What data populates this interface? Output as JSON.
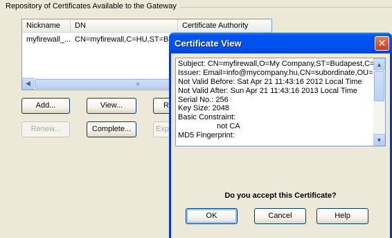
{
  "repository": {
    "title": "Repository of Certificates Available to the Gateway",
    "columns": [
      "Nickname",
      "DN",
      "Certificate Authority"
    ],
    "rows": [
      {
        "nickname": "myfirewall_...",
        "dn": "CN=myfirewall,C=HU,ST=B...",
        "ca": ""
      }
    ]
  },
  "buttons": {
    "add": "Add...",
    "view": "View...",
    "remove_partial": "R",
    "renew": "Renew...",
    "complete": "Complete...",
    "export_partial": "Exp"
  },
  "dialog": {
    "title": "Certificate View",
    "close_glyph": "✕",
    "lines": [
      "Subject: CN=myfirewall,O=My Company,ST=Budapest,C=HU",
      "Issuer: Email=info@mycompany.hu,CN=subordinate,OU=Se",
      "Not Valid Before: Sat Apr 21 11:43:16 2012 Local Time",
      "Not Valid After:  Sun Apr 21 11:43:16 2013 Local Time",
      "Serial No.:  256",
      "Key Size:  2048",
      "Basic Constraint:",
      "not CA",
      "MD5 Fingerprint:"
    ],
    "question": "Do you accept this Certificate?",
    "ok": "OK",
    "cancel": "Cancel",
    "help": "Help"
  },
  "icons": {
    "left_arrow": "◀",
    "right_arrow": "▶",
    "up_arrow": "▲",
    "down_arrow": "▼",
    "grip": "≡"
  },
  "colors": {
    "title_bar": "#0054e3",
    "close_button": "#c9431c",
    "window_bg": "#ece9d8"
  }
}
